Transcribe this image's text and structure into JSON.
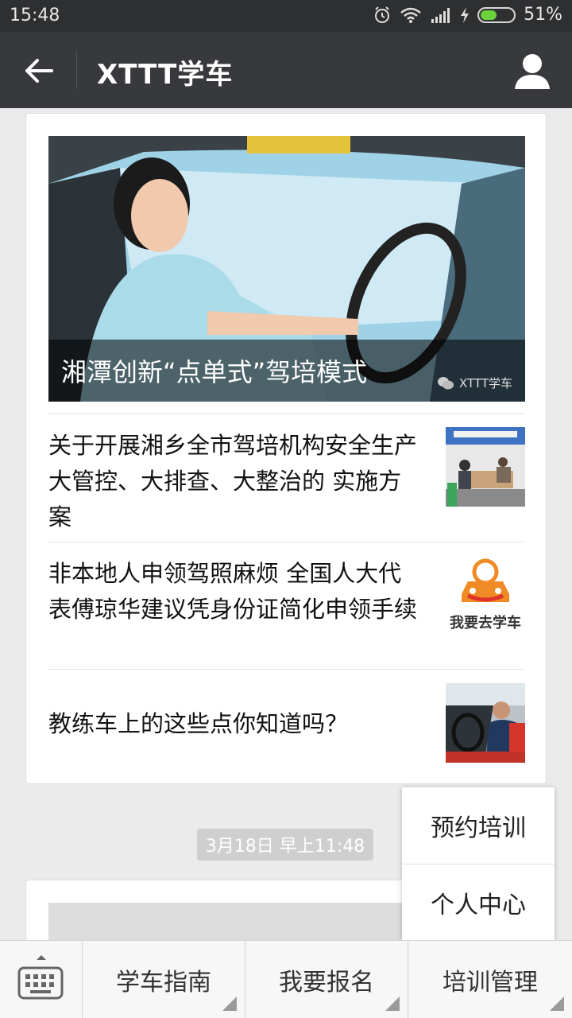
{
  "status_bar": {
    "time": "15:48",
    "battery_percent": "51%",
    "battery_level": 0.51
  },
  "header": {
    "title": "XTTT学车"
  },
  "article_card": {
    "hero": {
      "title": "湘潭创新“点单式”驾培模式",
      "watermark": "XTTT学车"
    },
    "items": [
      {
        "title": "关于开展湘乡全市驾培机构安全生产大管控、大排查、大整治的 实施方案"
      },
      {
        "title": "非本地人申领驾照麻烦 全国人大代表傅琼华建议凭身份证简化申领手续",
        "thumb_text": "我要去学车"
      },
      {
        "title": "教练车上的这些点你知道吗？"
      }
    ]
  },
  "timestamp": "3月18日 早上11:48",
  "popup_menu": {
    "items": [
      "预约培训",
      "个人中心"
    ]
  },
  "bottom_menu": {
    "items": [
      "学车指南",
      "我要报名",
      "培训管理"
    ]
  },
  "colors": {
    "titlebar": "#37393c",
    "statusbar": "#2e2f31",
    "battery": "#6bd33c",
    "logo_orange": "#f08a24",
    "logo_red": "#e0322b"
  },
  "icons": {
    "back": "arrow-left-icon",
    "profile": "person-icon",
    "keyboard": "keyboard-icon",
    "wechat": "wechat-icon"
  }
}
